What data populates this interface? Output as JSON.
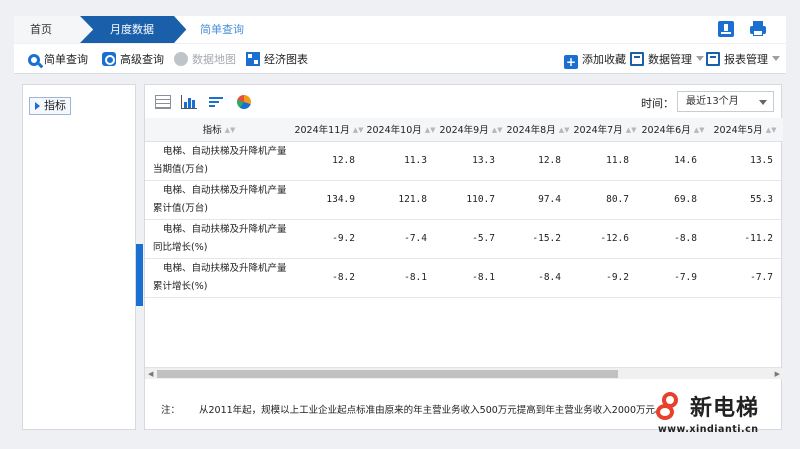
{
  "breadcrumb": {
    "home": "首页",
    "monthly": "月度数据",
    "simple": "简单查询"
  },
  "top_icons": {
    "download": "download-icon",
    "print": "print-icon"
  },
  "toolbar": {
    "simple_query": "简单查询",
    "advanced_query": "高级查询",
    "data_map": "数据地图",
    "econ_chart": "经济图表",
    "add_favorite": "添加收藏",
    "data_manage": "数据管理",
    "report_manage": "报表管理"
  },
  "left_panel": {
    "tab_label": "指标"
  },
  "main": {
    "time_label": "时间：",
    "time_select": "最近13个月",
    "columns": [
      "指标",
      "2024年11月",
      "2024年10月",
      "2024年9月",
      "2024年8月",
      "2024年7月",
      "2024年6月",
      "2024年5月"
    ],
    "rows": [
      {
        "name_l1": "电梯、自动扶梯及升降机产量",
        "name_l2": "当期值(万台)",
        "values": [
          "12.8",
          "11.3",
          "13.3",
          "12.8",
          "11.8",
          "14.6",
          "13.5"
        ]
      },
      {
        "name_l1": "电梯、自动扶梯及升降机产量",
        "name_l2": "累计值(万台)",
        "values": [
          "134.9",
          "121.8",
          "110.7",
          "97.4",
          "80.7",
          "69.8",
          "55.3"
        ]
      },
      {
        "name_l1": "电梯、自动扶梯及升降机产量",
        "name_l2": "同比增长(%)",
        "values": [
          "-9.2",
          "-7.4",
          "-5.7",
          "-15.2",
          "-12.6",
          "-8.8",
          "-11.2"
        ]
      },
      {
        "name_l1": "电梯、自动扶梯及升降机产量",
        "name_l2": "累计增长(%)",
        "values": [
          "-8.2",
          "-8.1",
          "-8.1",
          "-8.4",
          "-9.2",
          "-7.9",
          "-7.7"
        ]
      }
    ],
    "note_label": "注：",
    "note_text": "从2011年起，规模以上工业企业起点标准由原来的年主营业务收入500万元提高到年主营业务收入2000万元。"
  },
  "watermark": {
    "title": "新电梯",
    "url": "www.xindianti.cn"
  },
  "colors": {
    "accent": "#1a5fa9",
    "brand_red": "#e8412b"
  }
}
